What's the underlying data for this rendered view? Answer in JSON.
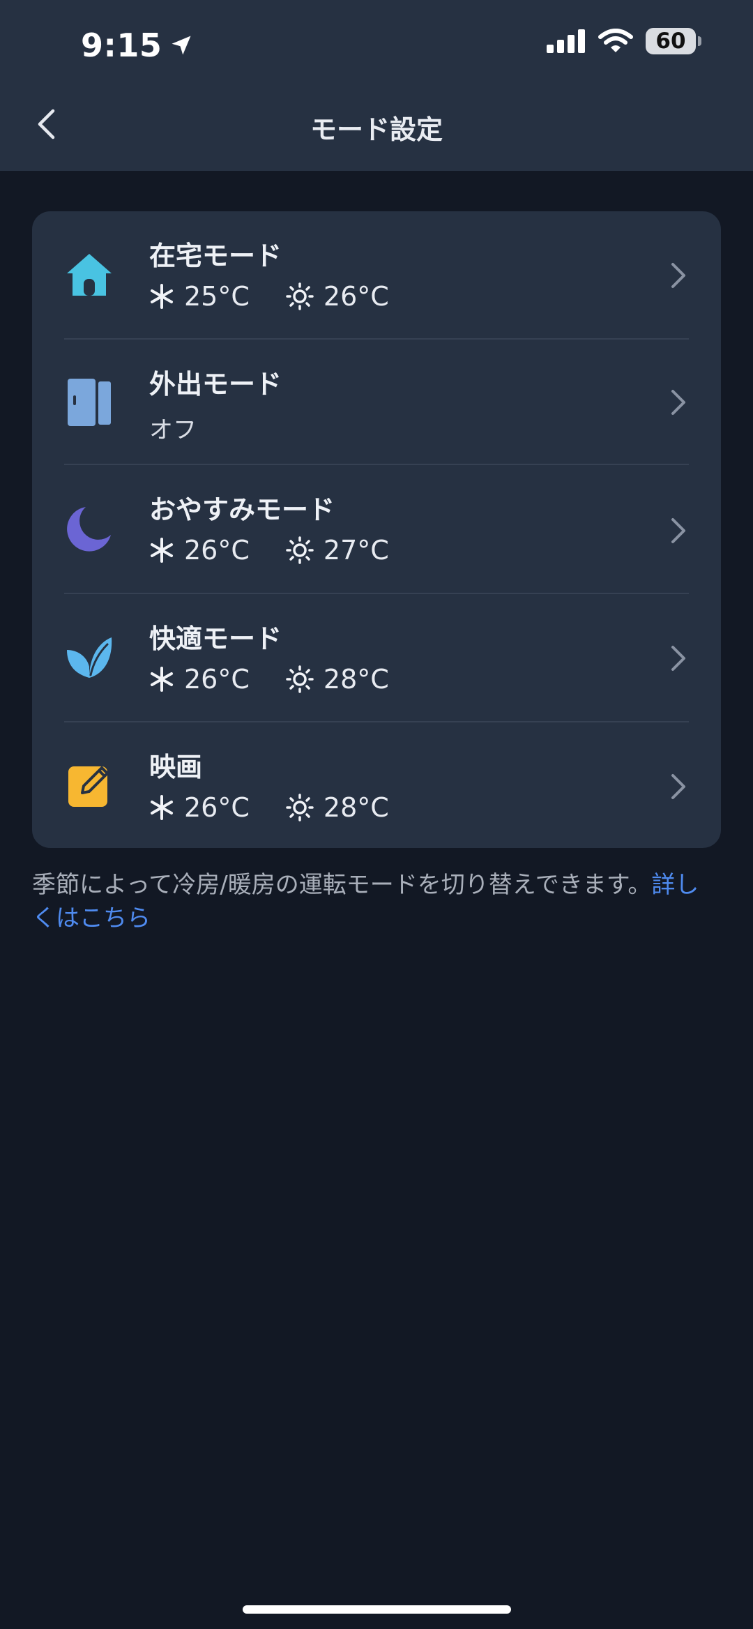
{
  "status_bar": {
    "time": "9:15",
    "battery": "60"
  },
  "nav": {
    "title": "モード設定"
  },
  "modes": [
    {
      "name": "在宅モード",
      "cool": "25°C",
      "heat": "26°C",
      "icon": "home-icon",
      "color": "#49C3E2"
    },
    {
      "name": "外出モード",
      "status": "オフ",
      "icon": "door-icon",
      "color": "#7BA7DC"
    },
    {
      "name": "おやすみモード",
      "cool": "26°C",
      "heat": "27°C",
      "icon": "moon-icon",
      "color": "#6B65D4"
    },
    {
      "name": "快適モード",
      "cool": "26°C",
      "heat": "28°C",
      "icon": "leaf-icon",
      "color": "#5CB7EE"
    },
    {
      "name": "映画",
      "cool": "26°C",
      "heat": "28°C",
      "icon": "edit-note-icon",
      "color": "#F7B731"
    }
  ],
  "footer": {
    "text": "季節によって冷房/暖房の運転モードを切り替えできます。",
    "link": "詳しくはこちら"
  }
}
